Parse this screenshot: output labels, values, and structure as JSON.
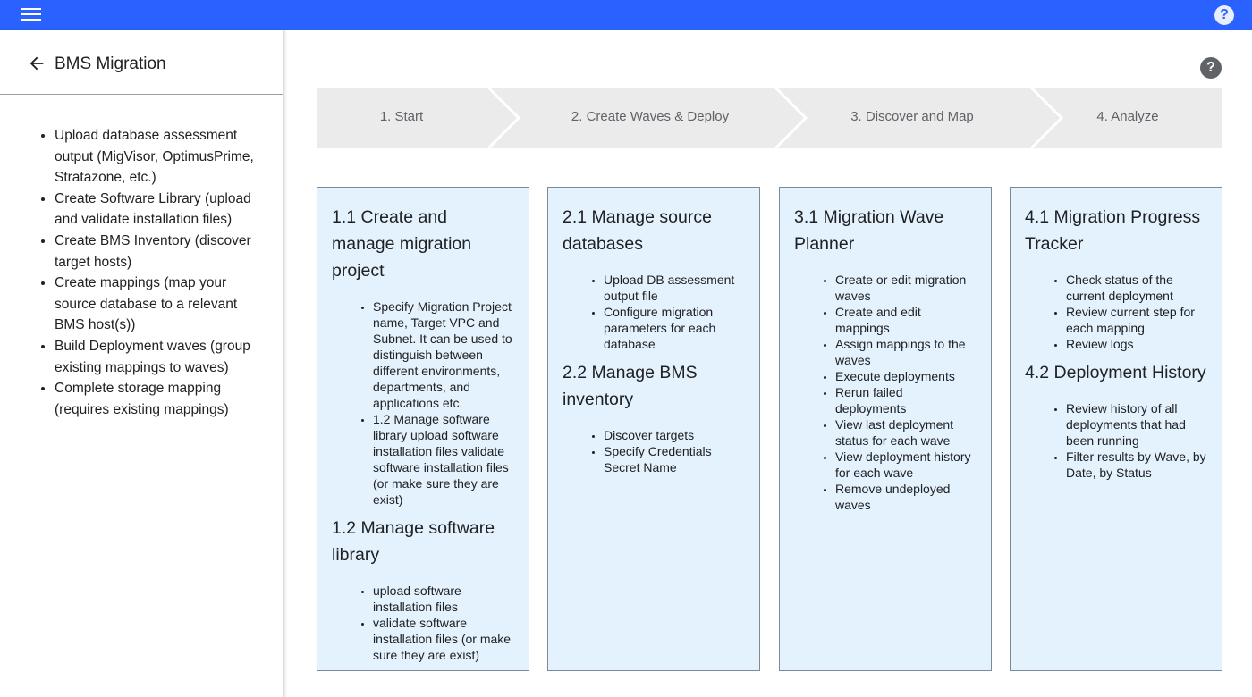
{
  "topbar": {
    "menu_icon": "hamburger-menu-icon",
    "help_icon": "help-circle-icon",
    "help_glyph": "?"
  },
  "sidebar": {
    "title": "BMS Migration",
    "items": [
      "Upload database assessment output (MigVisor, OptimusPrime, Stratazone, etc.)",
      "Create Software Library (upload and validate installation files)",
      "Create BMS Inventory (discover target hosts)",
      "Create mappings (map your source database to a relevant BMS host(s))",
      "Build Deployment waves (group existing mappings to waves)",
      "Complete storage mapping (requires existing mappings)"
    ]
  },
  "main": {
    "help_glyph": "?"
  },
  "steps": [
    "1. Start",
    "2. Create Waves & Deploy",
    "3. Discover and Map",
    "4. Analyze"
  ],
  "cards": [
    {
      "sections": [
        {
          "title": "1.1 Create and manage migration project",
          "items": [
            "Specify Migration Project name, Target VPC and Subnet. It can be used to distinguish between different environments, departments, and applications etc.",
            "1.2 Manage software library upload software installation files validate software installation files (or make sure they are exist)"
          ]
        },
        {
          "title": "1.2 Manage software library",
          "items": [
            "upload software installation files",
            "validate software installation files (or make sure they are exist)"
          ]
        }
      ]
    },
    {
      "sections": [
        {
          "title": "2.1 Manage source databases",
          "items": [
            "Upload DB assessment output file",
            "Configure migration parameters for each database"
          ]
        },
        {
          "title": "2.2 Manage BMS inventory",
          "items": [
            "Discover targets",
            "Specify Credentials Secret Name"
          ]
        }
      ]
    },
    {
      "sections": [
        {
          "title": "3.1 Migration Wave Planner",
          "items": [
            "Create or edit migration waves",
            "Create and edit mappings",
            "Assign mappings to the waves",
            "Execute deployments",
            "Rerun failed deployments",
            "View last deployment status for each wave",
            "View deployment history for each wave",
            "Remove undeployed waves"
          ]
        }
      ]
    },
    {
      "sections": [
        {
          "title": "4.1 Migration Progress Tracker",
          "items": [
            "Check status of the current deployment",
            "Review current step for each mapping",
            "Review logs"
          ]
        },
        {
          "title": "4.2 Deployment History",
          "items": [
            "Review history of all deployments that had been running",
            "Filter results by Wave, by Date, by Status"
          ]
        }
      ]
    }
  ],
  "colors": {
    "topbar": "#2962ff",
    "card_bg": "#e3f2fd",
    "stepper_bg": "#ebebeb"
  }
}
